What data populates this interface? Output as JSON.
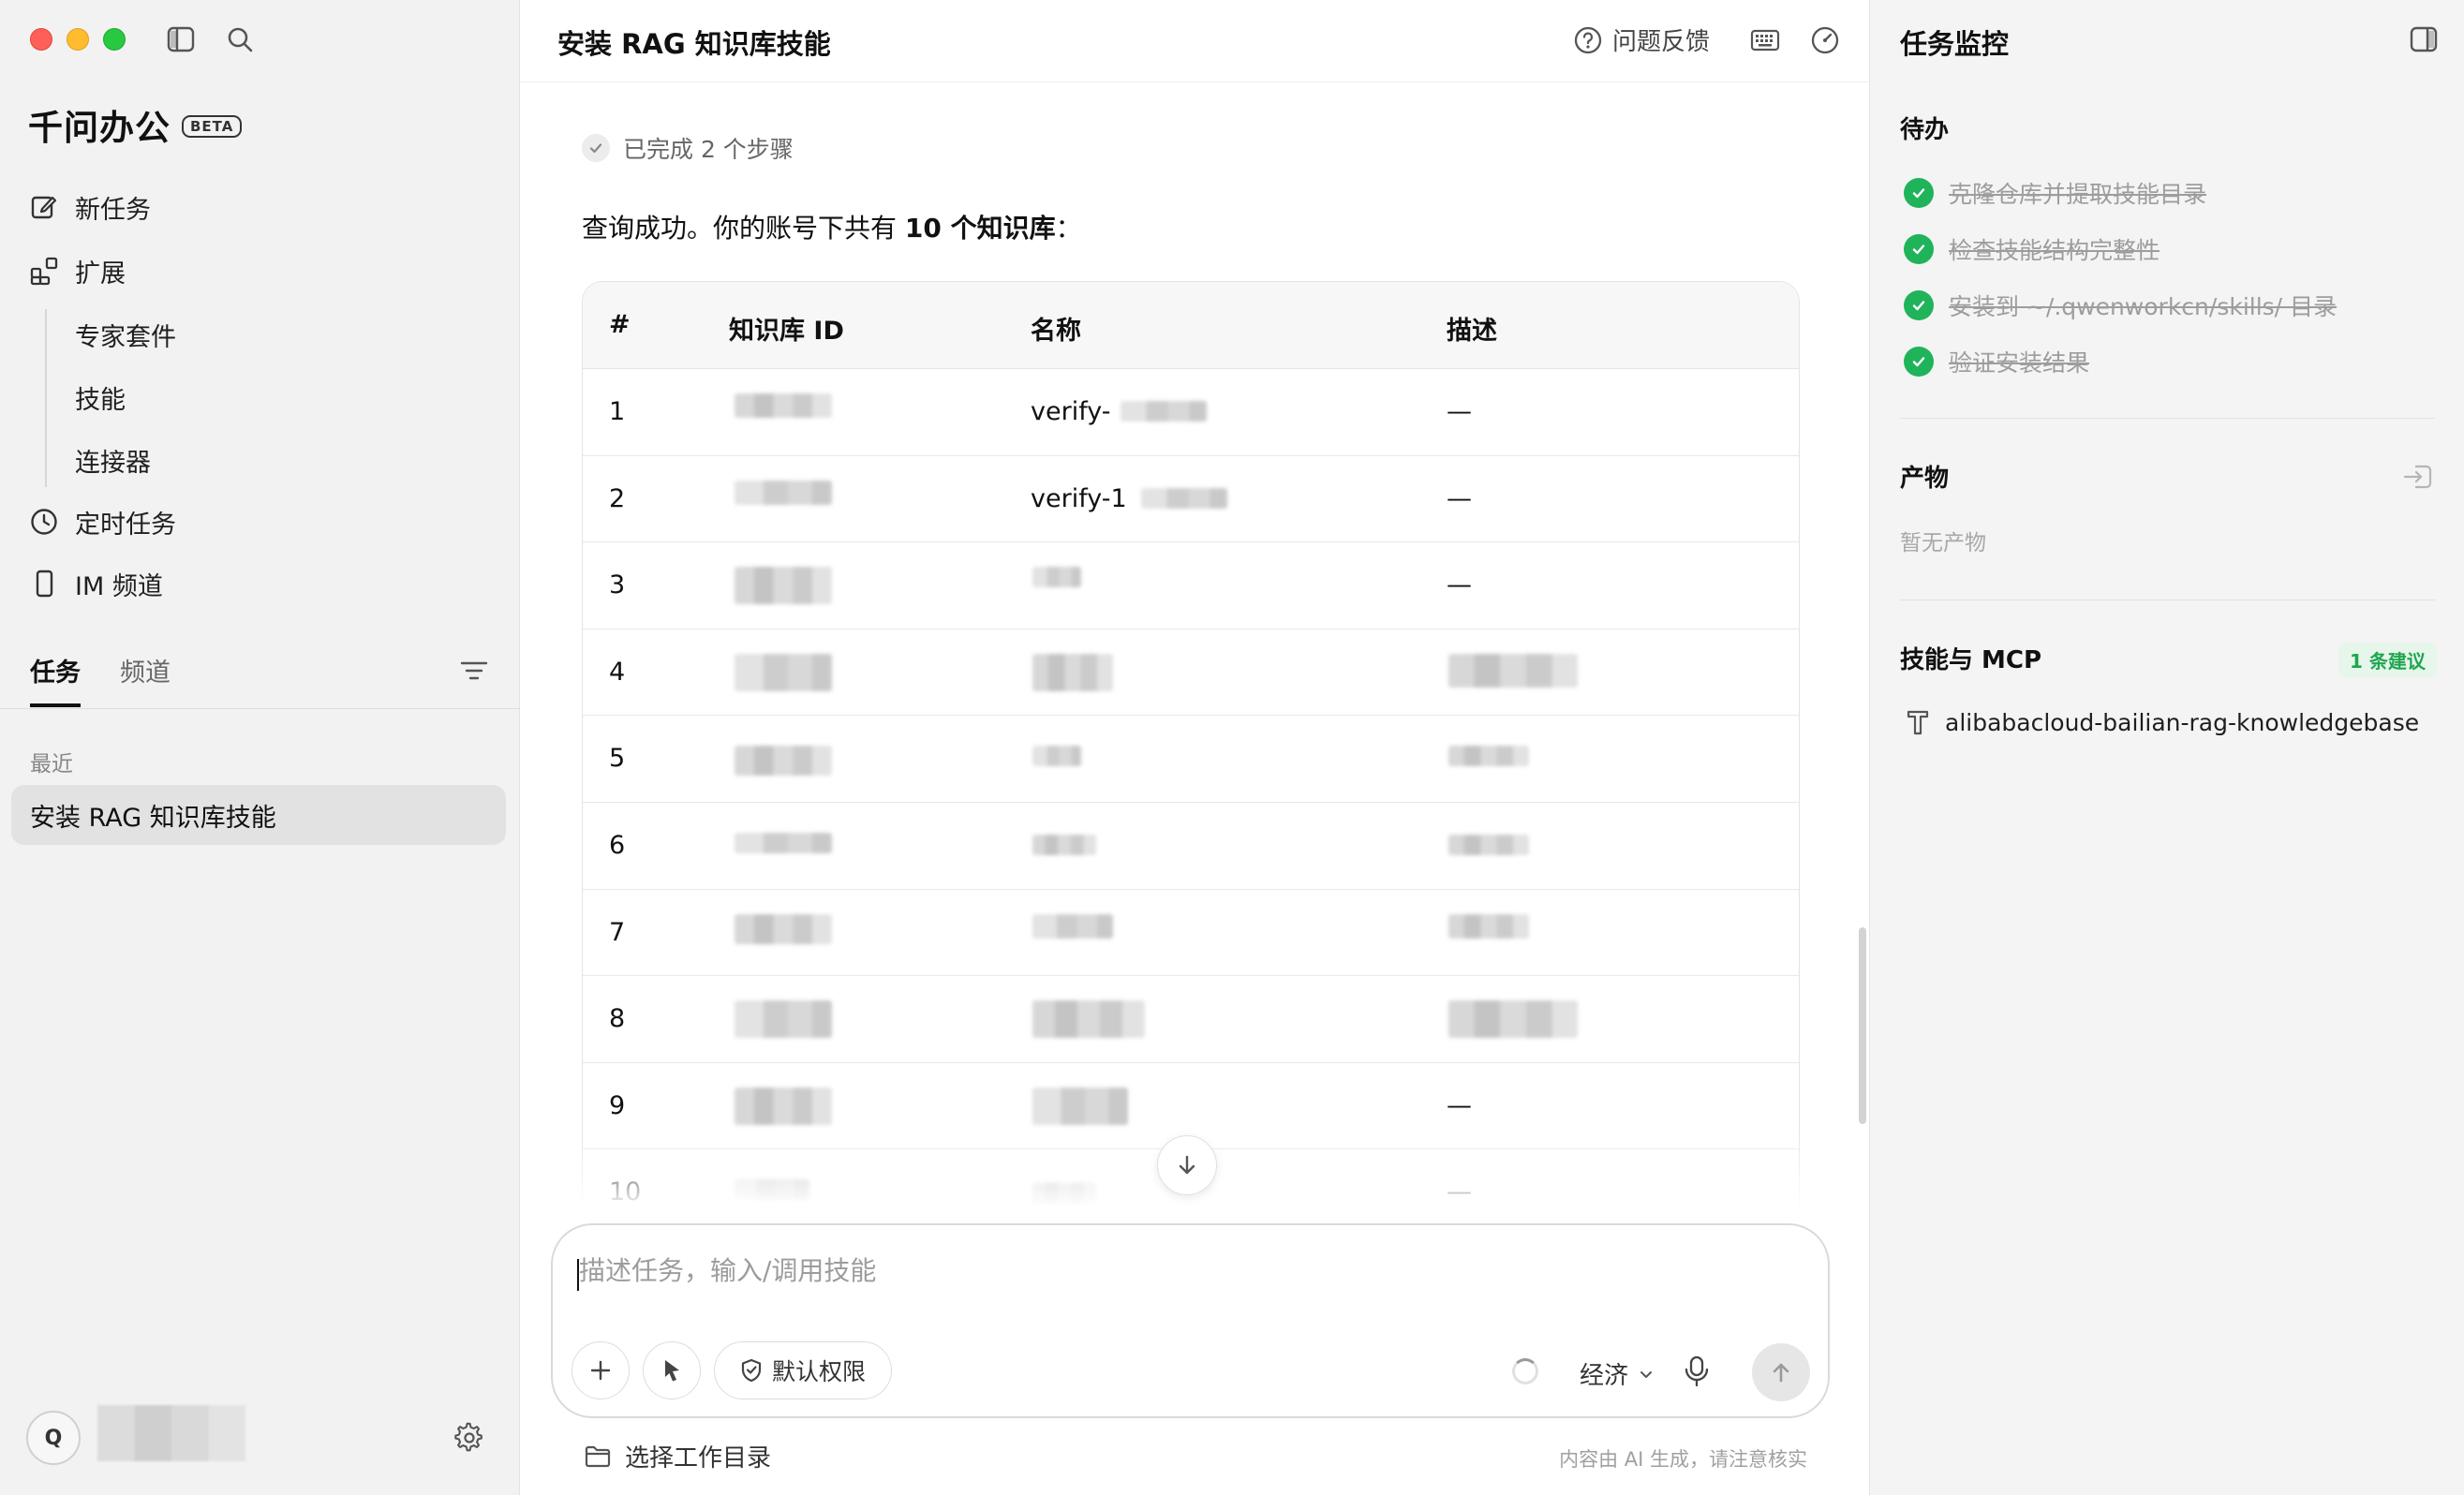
{
  "sidebar": {
    "brand": "千问办公",
    "beta": "BETA",
    "nav": {
      "new_task": "新任务",
      "extend": "扩展",
      "expert_suite": "专家套件",
      "skills": "技能",
      "connectors": "连接器",
      "scheduled": "定时任务",
      "im_channel": "IM 频道"
    },
    "tabs": {
      "tasks": "任务",
      "channels": "频道"
    },
    "recent_label": "最近",
    "recent_item": "安装 RAG 知识库技能",
    "avatar_letter": "Q"
  },
  "main": {
    "title": "安装 RAG 知识库技能",
    "feedback": "问题反馈",
    "steps_done": "已完成 2 个步骤",
    "result_pre": "查询成功。你的账号下共有 ",
    "result_bold": "10 个知识库",
    "result_post": "：",
    "table": {
      "headers": [
        "#",
        "知识库 ID",
        "名称",
        "描述"
      ],
      "rows": [
        {
          "num": "1",
          "name_prefix": "verify-",
          "desc": "—"
        },
        {
          "num": "2",
          "name_prefix": "verify-1",
          "desc": "—"
        },
        {
          "num": "3",
          "name_prefix": "",
          "desc": "—"
        },
        {
          "num": "4",
          "name_prefix": "",
          "desc": ""
        },
        {
          "num": "5",
          "name_prefix": "",
          "desc": ""
        },
        {
          "num": "6",
          "name_prefix": "",
          "desc": ""
        },
        {
          "num": "7",
          "name_prefix": "",
          "desc": ""
        },
        {
          "num": "8",
          "name_prefix": "",
          "desc": ""
        },
        {
          "num": "9",
          "name_prefix": "",
          "desc": "—"
        },
        {
          "num": "10",
          "name_prefix": "",
          "desc": "—"
        }
      ]
    },
    "composer": {
      "placeholder": "描述任务，输入/调用技能",
      "permission": "默认权限",
      "mode": "经济"
    },
    "workdir": "选择工作目录",
    "disclaimer": "内容由 AI 生成，请注意核实"
  },
  "panel": {
    "title": "任务监控",
    "todo_title": "待办",
    "todos": [
      "克隆仓库并提取技能目录",
      "检查技能结构完整性",
      "安装到 ~/.qwenworkcn/skills/ 目录",
      "验证安装结果"
    ],
    "artifacts_title": "产物",
    "artifacts_empty": "暂无产物",
    "skills_title": "技能与 MCP",
    "suggest_badge": "1 条建议",
    "skill_name": "alibabacloud-bailian-rag-knowledgebase"
  },
  "colors": {
    "accent_green": "#1fb45a",
    "traffic_red": "#fe5f57",
    "traffic_yellow": "#febc2e",
    "traffic_green": "#28c840"
  }
}
